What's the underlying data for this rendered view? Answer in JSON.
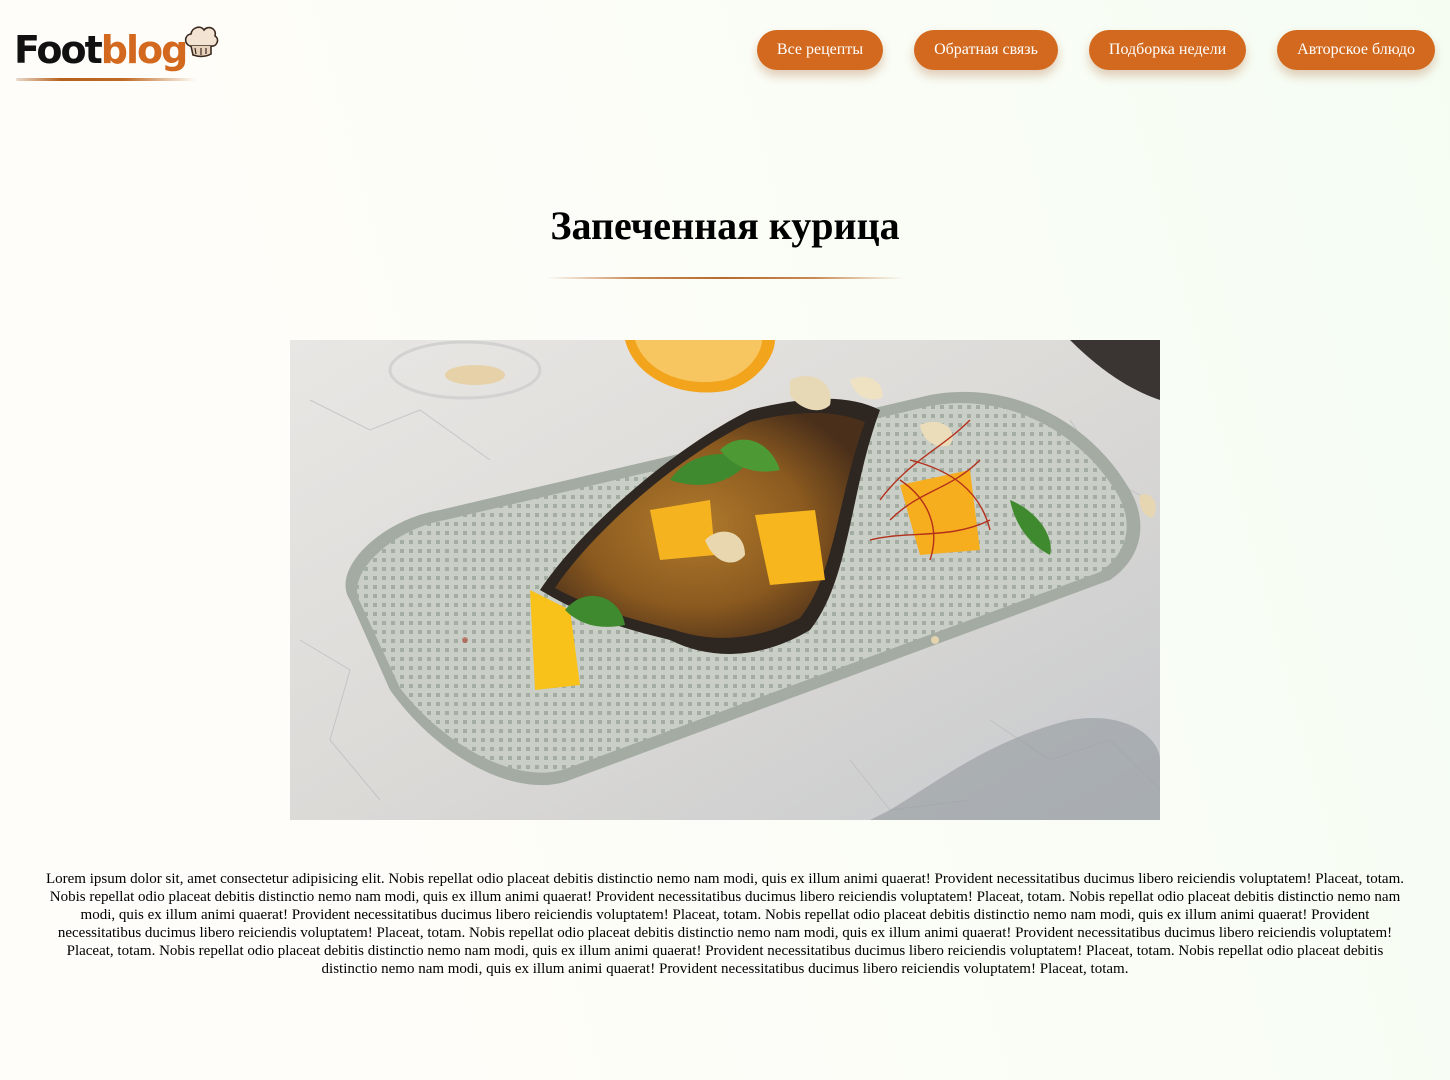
{
  "header": {
    "logo": {
      "part1": "Foot",
      "part2": "blog",
      "colors": {
        "dark": "#111111",
        "accent": "#d2691e"
      },
      "icon": "chef-hat-icon"
    },
    "nav": [
      {
        "label": "Все рецепты"
      },
      {
        "label": "Обратная связь"
      },
      {
        "label": "Подборка недели"
      },
      {
        "label": "Авторское блюдо"
      }
    ],
    "nav_color": "#d2691e"
  },
  "main": {
    "title": "Запеченная курица",
    "image": {
      "subject": "roasted eggplant with orange slices, cashews and cilantro on a grey plate"
    },
    "text": "Lorem ipsum dolor sit, amet consectetur adipisicing elit. Nobis repellat odio placeat debitis distinctio nemo nam modi, quis ex illum animi quaerat! Provident necessitatibus ducimus libero reiciendis voluptatem! Placeat, totam. Nobis repellat odio placeat debitis distinctio nemo nam modi, quis ex illum animi quaerat! Provident necessitatibus ducimus libero reiciendis voluptatem! Placeat, totam. Nobis repellat odio placeat debitis distinctio nemo nam modi, quis ex illum animi quaerat! Provident necessitatibus ducimus libero reiciendis voluptatem! Placeat, totam. Nobis repellat odio placeat debitis distinctio nemo nam modi, quis ex illum animi quaerat! Provident necessitatibus ducimus libero reiciendis voluptatem! Placeat, totam. Nobis repellat odio placeat debitis distinctio nemo nam modi, quis ex illum animi quaerat! Provident necessitatibus ducimus libero reiciendis voluptatem! Placeat, totam. Nobis repellat odio placeat debitis distinctio nemo nam modi, quis ex illum animi quaerat! Provident necessitatibus ducimus libero reiciendis voluptatem! Placeat, totam. Nobis repellat odio placeat debitis distinctio nemo nam modi, quis ex illum animi quaerat! Provident necessitatibus ducimus libero reiciendis voluptatem! Placeat, totam."
  }
}
